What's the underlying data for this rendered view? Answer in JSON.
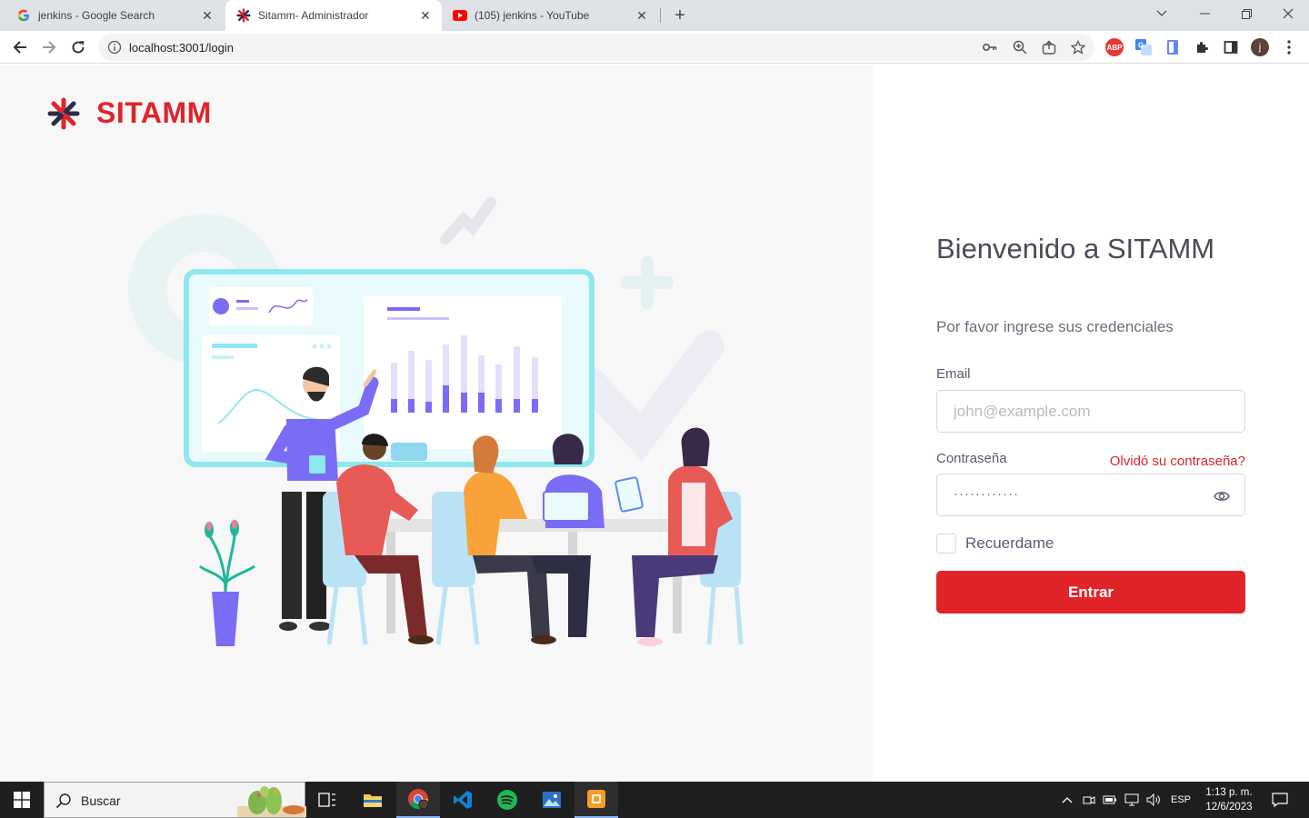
{
  "browser": {
    "tabs": [
      {
        "title": "jenkins - Google Search",
        "active": false
      },
      {
        "title": "Sitamm- Administrador",
        "active": true
      },
      {
        "title": "(105) jenkins - YouTube",
        "active": false
      }
    ],
    "url": "localhost:3001/login",
    "profile_initial": "j",
    "ext_abp": "ABP"
  },
  "brand": {
    "name": "SITAMM",
    "color": "#e0242a"
  },
  "login": {
    "welcome": "Bienvenido a SITAMM",
    "subtitle": "Por favor ingrese sus credenciales",
    "email_label": "Email",
    "email_placeholder": "john@example.com",
    "password_label": "Contraseña",
    "forgot_link": "Olvidó su contraseña?",
    "password_value": "············",
    "remember_label": "Recuerdame",
    "submit_label": "Entrar"
  },
  "taskbar": {
    "search_text": "Buscar",
    "lang": "ESP",
    "time": "1:13 p. m.",
    "date": "12/6/2023"
  }
}
